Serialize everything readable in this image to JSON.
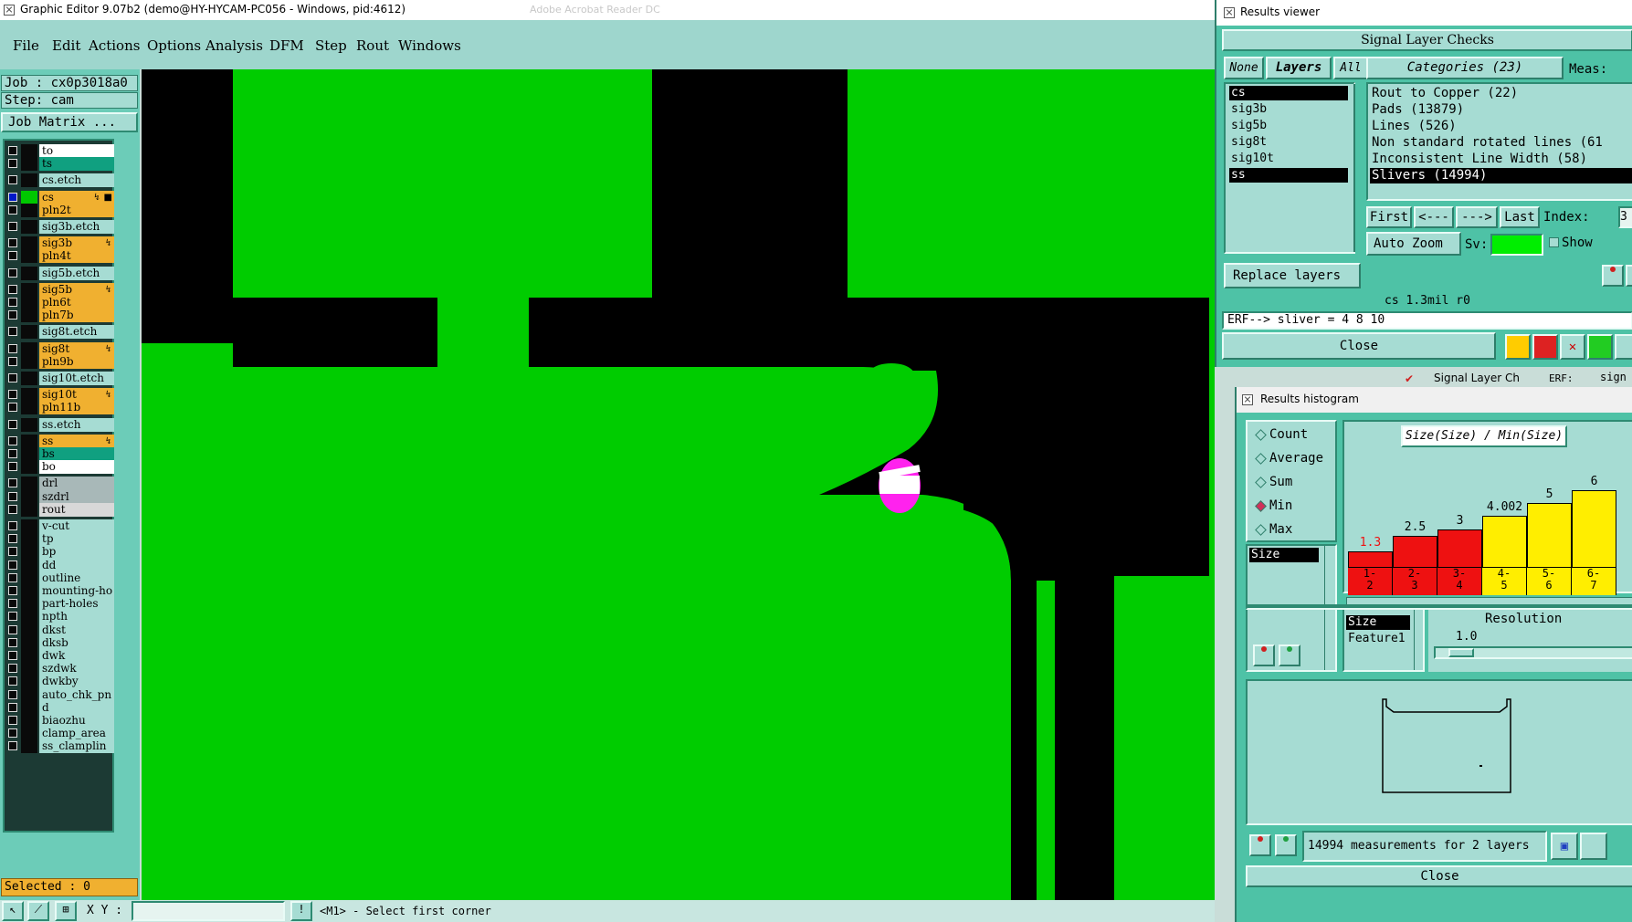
{
  "titlebar": {
    "title": "Graphic Editor 9.07b2 (demo@HY-HYCAM-PC056 - Windows, pid:4612)",
    "bg_text": "Adobe Acrobat Reader DC"
  },
  "menu": [
    "File",
    "Edit",
    "Actions",
    "Options",
    "Analysis",
    "DFM",
    "Step",
    "Rout",
    "Windows"
  ],
  "job": {
    "job_label": "Job : cx0p3018a0",
    "step_label": "Step: cam",
    "matrix_button": "Job Matrix ..."
  },
  "layers": [
    {
      "name": "to",
      "color": "#ffffff",
      "checked": false,
      "active": false
    },
    {
      "name": "ts",
      "color": "#10a080",
      "checked": false,
      "active": false
    },
    {
      "name": "cs.etch",
      "color": "#a6dcd3",
      "checked": false,
      "active": false
    },
    {
      "name": "cs",
      "color": "#f0b030",
      "checked": true,
      "active": true,
      "flag": "↯ ■"
    },
    {
      "name": "pln2t",
      "color": "#f0b030",
      "checked": false,
      "active": false
    },
    {
      "name": "sig3b.etch",
      "color": "#a6dcd3",
      "checked": false,
      "active": false
    },
    {
      "name": "sig3b",
      "color": "#f0b030",
      "checked": false,
      "active": false,
      "flag": "↯"
    },
    {
      "name": "pln4t",
      "color": "#f0b030",
      "checked": false,
      "active": false
    },
    {
      "name": "sig5b.etch",
      "color": "#a6dcd3",
      "checked": false,
      "active": false
    },
    {
      "name": "sig5b",
      "color": "#f0b030",
      "checked": false,
      "active": false,
      "flag": "↯"
    },
    {
      "name": "pln6t",
      "color": "#f0b030",
      "checked": false,
      "active": false
    },
    {
      "name": "pln7b",
      "color": "#f0b030",
      "checked": false,
      "active": false
    },
    {
      "name": "sig8t.etch",
      "color": "#a6dcd3",
      "checked": false,
      "active": false
    },
    {
      "name": "sig8t",
      "color": "#f0b030",
      "checked": false,
      "active": false,
      "flag": "↯"
    },
    {
      "name": "pln9b",
      "color": "#f0b030",
      "checked": false,
      "active": false
    },
    {
      "name": "sig10t.etch",
      "color": "#a6dcd3",
      "checked": false,
      "active": false
    },
    {
      "name": "sig10t",
      "color": "#f0b030",
      "checked": false,
      "active": false,
      "flag": "↯"
    },
    {
      "name": "pln11b",
      "color": "#f0b030",
      "checked": false,
      "active": false
    },
    {
      "name": "ss.etch",
      "color": "#a6dcd3",
      "checked": false,
      "active": false
    },
    {
      "name": "ss",
      "color": "#f0b030",
      "checked": false,
      "active": false,
      "flag": "↯"
    },
    {
      "name": "bs",
      "color": "#10a080",
      "checked": false,
      "active": false
    },
    {
      "name": "bo",
      "color": "#ffffff",
      "checked": false,
      "active": false
    },
    {
      "name": "drl",
      "color": "#a8b8b8",
      "checked": false,
      "active": false
    },
    {
      "name": "szdrl",
      "color": "#a8b8b8",
      "checked": false,
      "active": false
    },
    {
      "name": "rout",
      "color": "#d8d8d8",
      "checked": false,
      "active": false
    },
    {
      "name": "v-cut",
      "color": "#a6dcd3",
      "checked": false,
      "active": false
    },
    {
      "name": "tp",
      "color": "#a6dcd3",
      "checked": false,
      "active": false
    },
    {
      "name": "bp",
      "color": "#a6dcd3",
      "checked": false,
      "active": false
    },
    {
      "name": "dd",
      "color": "#a6dcd3",
      "checked": false,
      "active": false
    },
    {
      "name": "outline",
      "color": "#a6dcd3",
      "checked": false,
      "active": false
    },
    {
      "name": "mounting-ho",
      "color": "#a6dcd3",
      "checked": false,
      "active": false
    },
    {
      "name": "part-holes",
      "color": "#a6dcd3",
      "checked": false,
      "active": false
    },
    {
      "name": "npth",
      "color": "#a6dcd3",
      "checked": false,
      "active": false
    },
    {
      "name": "dkst",
      "color": "#a6dcd3",
      "checked": false,
      "active": false
    },
    {
      "name": "dksb",
      "color": "#a6dcd3",
      "checked": false,
      "active": false
    },
    {
      "name": "dwk",
      "color": "#a6dcd3",
      "checked": false,
      "active": false
    },
    {
      "name": "szdwk",
      "color": "#a6dcd3",
      "checked": false,
      "active": false
    },
    {
      "name": "dwkby",
      "color": "#a6dcd3",
      "checked": false,
      "active": false
    },
    {
      "name": "auto_chk_pn",
      "color": "#a6dcd3",
      "checked": false,
      "active": false
    },
    {
      "name": "d",
      "color": "#a6dcd3",
      "checked": false,
      "active": false
    },
    {
      "name": "biaozhu",
      "color": "#a6dcd3",
      "checked": false,
      "active": false
    },
    {
      "name": "clamp_area",
      "color": "#a6dcd3",
      "checked": false,
      "active": false
    },
    {
      "name": "ss_clamplin",
      "color": "#a6dcd3",
      "checked": false,
      "active": false
    }
  ],
  "status": {
    "selected": "Selected : 0",
    "xy_label": "X Y :",
    "prompt": "<M1> - Select first corner",
    "xy_value": ""
  },
  "results_viewer": {
    "title": "Results viewer",
    "checks_title": "Signal Layer Checks",
    "filter_none": "None",
    "filter_layers": "Layers",
    "filter_all": "All",
    "layer_items": [
      "cs",
      "sig3b",
      "sig5b",
      "sig8t",
      "sig10t",
      "ss"
    ],
    "categories_header": "Categories (23)",
    "meas_label": "Meas:",
    "categories": [
      "Rout to Copper (22)",
      "Pads (13879)",
      "Lines (526)",
      "Non standard rotated lines (61",
      "Inconsistent Line Width (58)",
      "Slivers (14994)"
    ],
    "nav": [
      "First",
      "<---",
      "--->",
      "Last"
    ],
    "index_label": "Index:",
    "index_value": "3",
    "auto_zoom": "Auto Zoom",
    "sv_label": "Sv:",
    "show_label": "Show",
    "replace_layers": "Replace layers",
    "summary": "cs 1.3mil  r0",
    "erf": "ERF--> sliver = 4 8 10",
    "close": "Close",
    "behind_tab": "Signal Layer Ch",
    "behind_erf": "ERF:",
    "behind_sig": "sign"
  },
  "histogram": {
    "title": "Results histogram",
    "options": [
      "Count",
      "Average",
      "Sum",
      "Min",
      "Max"
    ],
    "selected_option": "Min",
    "chart_title": "Size(Size) / Min(Size)",
    "left_list": [
      "Size"
    ],
    "size_list": [
      "Size",
      "Feature1"
    ],
    "resolution_label": "Resolution",
    "resolution_value": "1.0",
    "measurements": "14994 measurements for 2 layers",
    "close": "Close"
  },
  "chart_data": {
    "type": "bar",
    "title": "Size(Size) / Min(Size)",
    "categories": [
      "1-2",
      "2-3",
      "3-4",
      "4-5",
      "5-6",
      "6-7"
    ],
    "values": [
      1.3,
      2.5,
      3,
      4.002,
      5,
      6
    ],
    "value_labels": [
      "1.3",
      "2.5",
      "3",
      "4.002",
      "5",
      "6"
    ],
    "bin_labels": [
      [
        "1-",
        "2"
      ],
      [
        "2-",
        "3"
      ],
      [
        "3-",
        "4"
      ],
      [
        "4-",
        "5"
      ],
      [
        "5-",
        "6"
      ],
      [
        "6-",
        "7"
      ]
    ],
    "colors": [
      "#ee1111",
      "#ee1111",
      "#ee1111",
      "#ffee00",
      "#ffee00",
      "#ffee00"
    ],
    "label_colors": [
      "#ee1111",
      "#000000",
      "#000000",
      "#000000",
      "#000000",
      "#000000"
    ],
    "ylim": [
      0,
      7.5
    ]
  },
  "colors": {
    "canvas_copper": "#00cc00",
    "canvas_bg": "#000000",
    "highlight": "#ff22ee",
    "panel": "#4ec2a6",
    "panel_light": "#a6dcd3"
  }
}
